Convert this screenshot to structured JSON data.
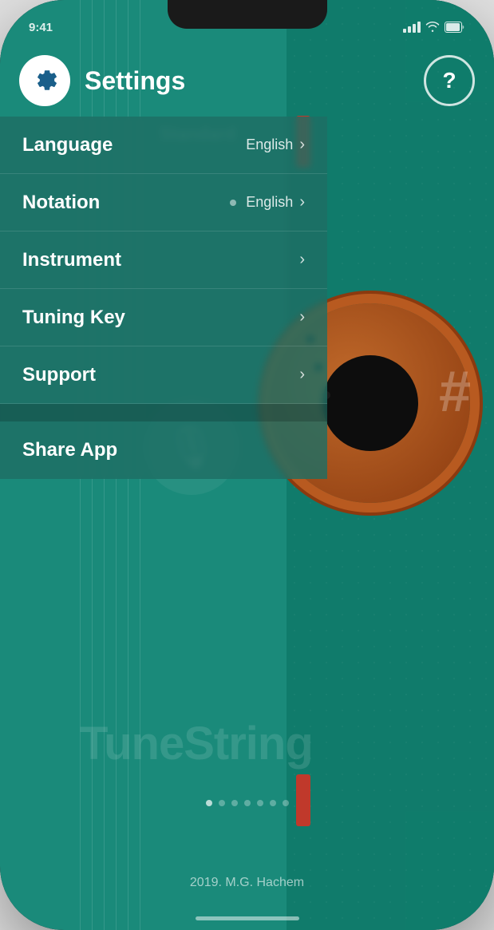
{
  "app": {
    "name": "TuneString",
    "tagline": "TuneString"
  },
  "status_bar": {
    "time": "9:41"
  },
  "header": {
    "title": "Settings",
    "help_label": "?"
  },
  "background": {
    "standard_label": "Standard"
  },
  "settings": {
    "items": [
      {
        "id": "language",
        "label": "Language",
        "value": "English",
        "has_chevron": true
      },
      {
        "id": "notation",
        "label": "Notation",
        "value": "English",
        "has_chevron": true
      },
      {
        "id": "instrument",
        "label": "Instrument",
        "value": "",
        "has_chevron": true
      },
      {
        "id": "tuning_key",
        "label": "Tuning Key",
        "value": "",
        "has_chevron": true
      },
      {
        "id": "support",
        "label": "Support",
        "value": "",
        "has_chevron": true
      }
    ],
    "share": {
      "label": "Share App"
    }
  },
  "footer": {
    "copyright": "2019. M.G. Hachem"
  },
  "colors": {
    "teal_dark": "#0f7a6a",
    "teal_main": "#1a8a7a",
    "panel_bg": "rgba(20, 95, 85, 0.85)",
    "accent_red": "#c0392b",
    "gear_blue": "#1a5f8a",
    "guitar_orange": "#c0692a"
  },
  "icons": {
    "gear": "gear-icon",
    "help": "?",
    "chevron": "›",
    "mic": "🎙"
  }
}
